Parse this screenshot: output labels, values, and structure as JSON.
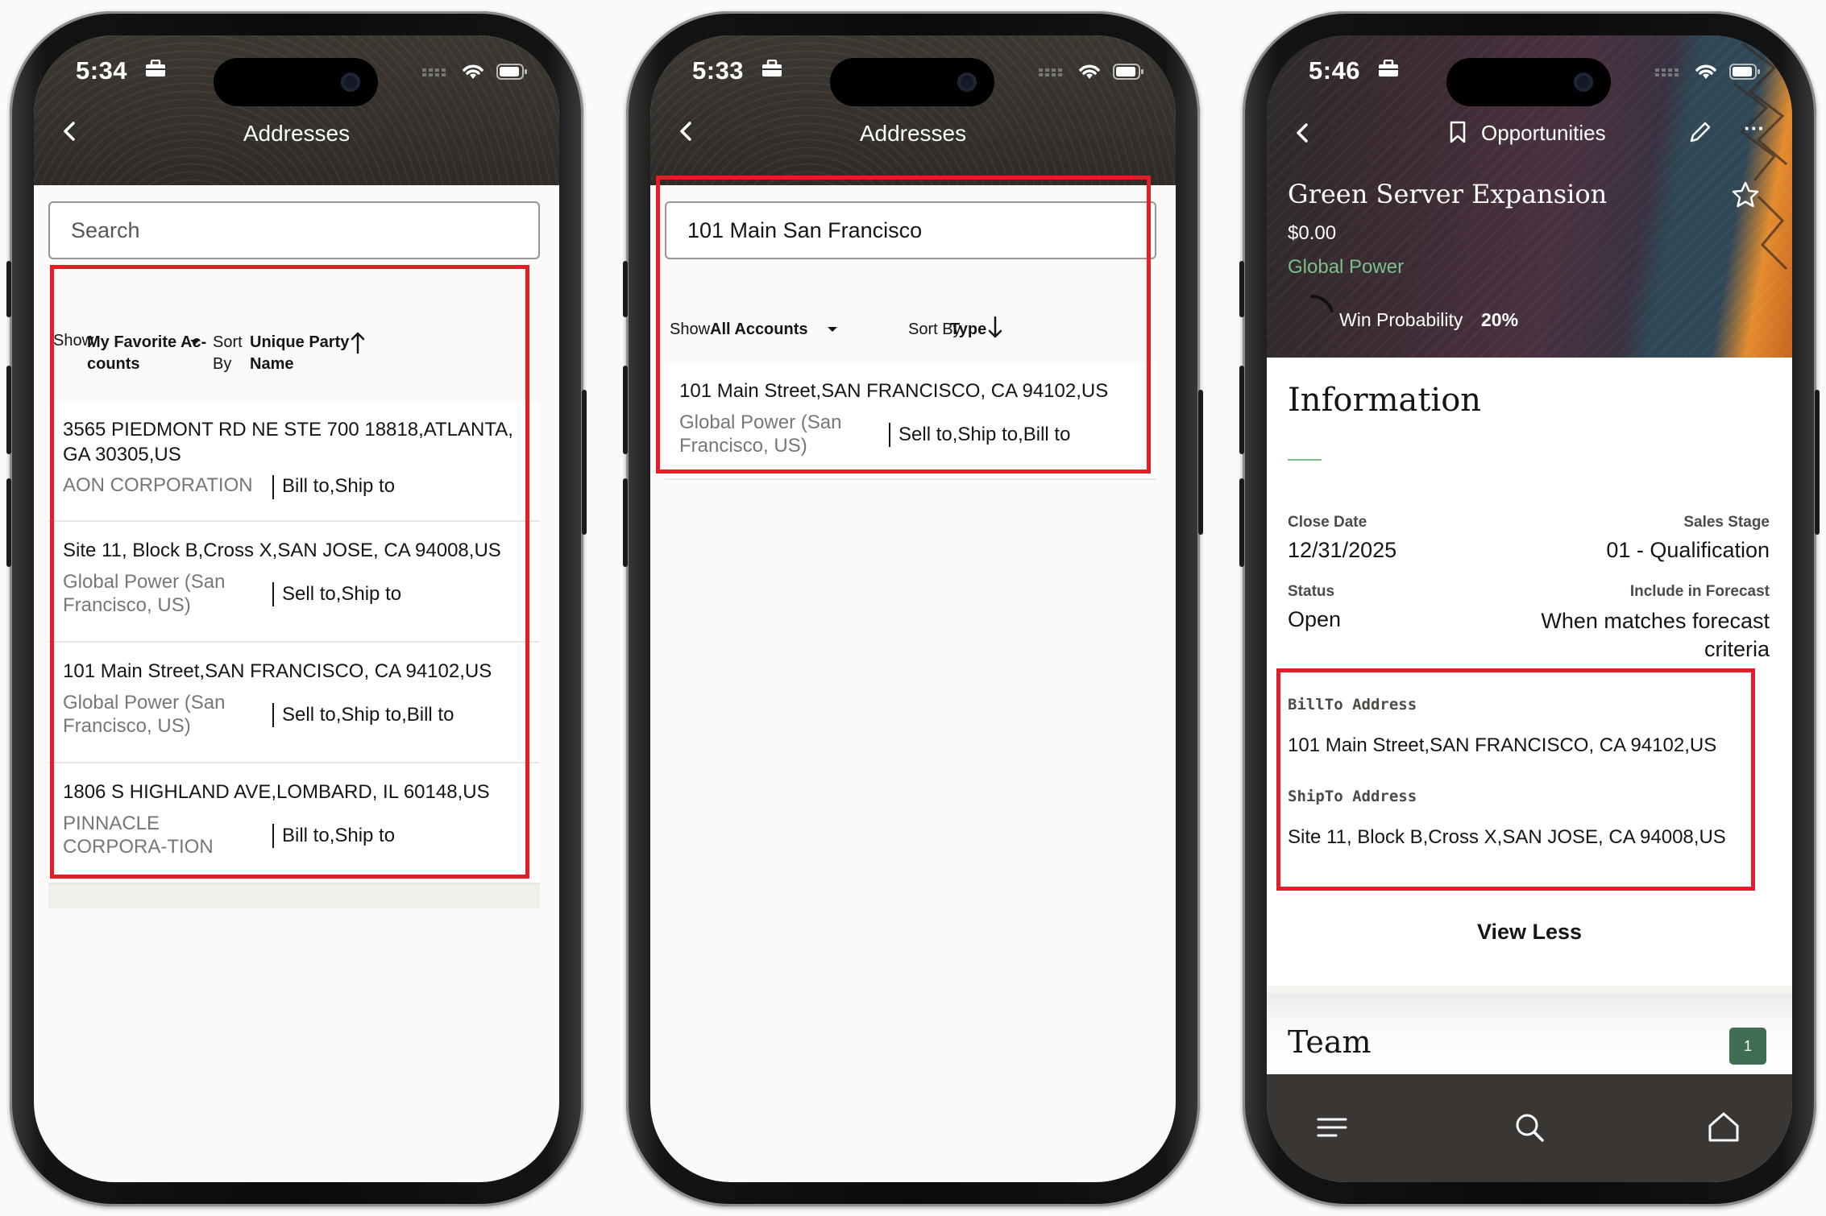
{
  "phone1": {
    "time": "5:34",
    "title": "Addresses",
    "search_placeholder": "Search",
    "filter": {
      "show_label": "Show",
      "show_value_line1": "My Favorite Ac-",
      "show_value_line2": "counts",
      "sort_label_line1": "Sort",
      "sort_label_line2": "By",
      "sort_value_line1": "Unique Party",
      "sort_value_line2": "Name"
    },
    "addresses": [
      {
        "address": "3565 PIEDMONT RD NE STE 700 18818,ATLANTA, GA 30305,US",
        "account": "AON CORPORATION",
        "purpose": "Bill to,Ship to"
      },
      {
        "address": "Site 11, Block B,Cross X,SAN JOSE, CA 94008,US",
        "account": "Global Power (San Francisco, US)",
        "purpose": "Sell to,Ship to"
      },
      {
        "address": "101 Main Street,SAN FRANCISCO, CA 94102,US",
        "account": "Global Power (San Francisco, US)",
        "purpose": "Sell to,Ship to,Bill to"
      },
      {
        "address": "1806 S HIGHLAND AVE,LOMBARD, IL 60148,US",
        "account": "PINNACLE CORPORA-TION",
        "purpose": "Bill to,Ship to"
      }
    ]
  },
  "phone2": {
    "time": "5:33",
    "title": "Addresses",
    "search_value": "101 Main San Francisco",
    "filter": {
      "show_label": "Show",
      "show_value": "All Accounts",
      "sort_label": "Sort By",
      "sort_value": "Type"
    },
    "addresses": [
      {
        "address": "101 Main Street,SAN FRANCISCO, CA 94102,US",
        "account": "Global Power (San Francisco, US)",
        "purpose": "Sell to,Ship to,Bill to"
      }
    ]
  },
  "phone3": {
    "time": "5:46",
    "header_title": "Opportunities",
    "opportunity_name": "Green Server Expansion",
    "amount": "$0.00",
    "account": "Global Power",
    "win_probability_label": "Win Probability",
    "win_probability_value": "20%",
    "win_probability": 0.2,
    "section_title": "Information",
    "fields": {
      "close_date_label": "Close Date",
      "close_date_value": "12/31/2025",
      "sales_stage_label": "Sales Stage",
      "sales_stage_value": "01 - Qualification",
      "status_label": "Status",
      "status_value": "Open",
      "forecast_label": "Include in Forecast",
      "forecast_value_line1": "When matches forecast",
      "forecast_value_line2": "criteria"
    },
    "billto_label": "BillTo Address",
    "billto_value": "101 Main Street,SAN FRANCISCO, CA 94102,US",
    "shipto_label": "ShipTo Address",
    "shipto_value": "Site 11, Block B,Cross X,SAN JOSE, CA 94008,US",
    "view_less": "View Less",
    "team_title": "Team",
    "team_count": "1"
  },
  "colors": {
    "highlight": "#e41e26",
    "header_bg": "#312d2a",
    "account_green": "#7bc08a",
    "team_badge": "#3f6e52"
  },
  "icons": [
    "back-icon",
    "briefcase-icon",
    "wifi-icon",
    "battery-icon",
    "cellular-icon",
    "dropdown-caret-icon",
    "sort-arrow-icon",
    "bookmark-icon",
    "edit-icon",
    "more-icon",
    "star-icon",
    "menu-icon",
    "search-icon",
    "home-icon"
  ]
}
